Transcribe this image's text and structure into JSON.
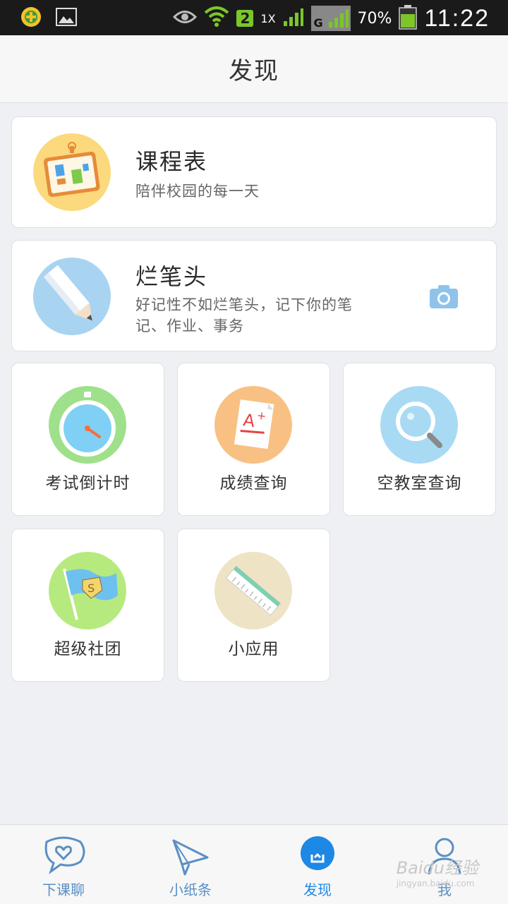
{
  "status_bar": {
    "time": "11:22",
    "battery_pct": "70%",
    "sim_slot": "2",
    "network_rate": "1X",
    "network_type": "G"
  },
  "header": {
    "title": "发现"
  },
  "cards": [
    {
      "title": "课程表",
      "subtitle": "陪伴校园的每一天"
    },
    {
      "title": "烂笔头",
      "subtitle_line1": "好记性不如烂笔头，记下你的笔",
      "subtitle_line2": "记、作业、事务"
    }
  ],
  "tiles": [
    {
      "label": "考试倒计时",
      "icon": "stopwatch-icon"
    },
    {
      "label": "成绩查询",
      "icon": "grade-paper-icon"
    },
    {
      "label": "空教室查询",
      "icon": "magnifier-icon"
    },
    {
      "label": "超级社团",
      "icon": "flag-icon"
    },
    {
      "label": "小应用",
      "icon": "ruler-icon"
    }
  ],
  "tabs": [
    {
      "label": "下课聊",
      "icon": "chat-heart-icon"
    },
    {
      "label": "小纸条",
      "icon": "paper-plane-icon"
    },
    {
      "label": "发现",
      "icon": "bulb-icon",
      "active": true
    },
    {
      "label": "我",
      "icon": "user-icon"
    }
  ],
  "watermark": {
    "brand": "Baidu经验",
    "url": "jingyan.baidu.com"
  },
  "colors": {
    "accent": "#1e88e5",
    "tab_inactive": "#5a8fc3",
    "background": "#eef0f3"
  }
}
